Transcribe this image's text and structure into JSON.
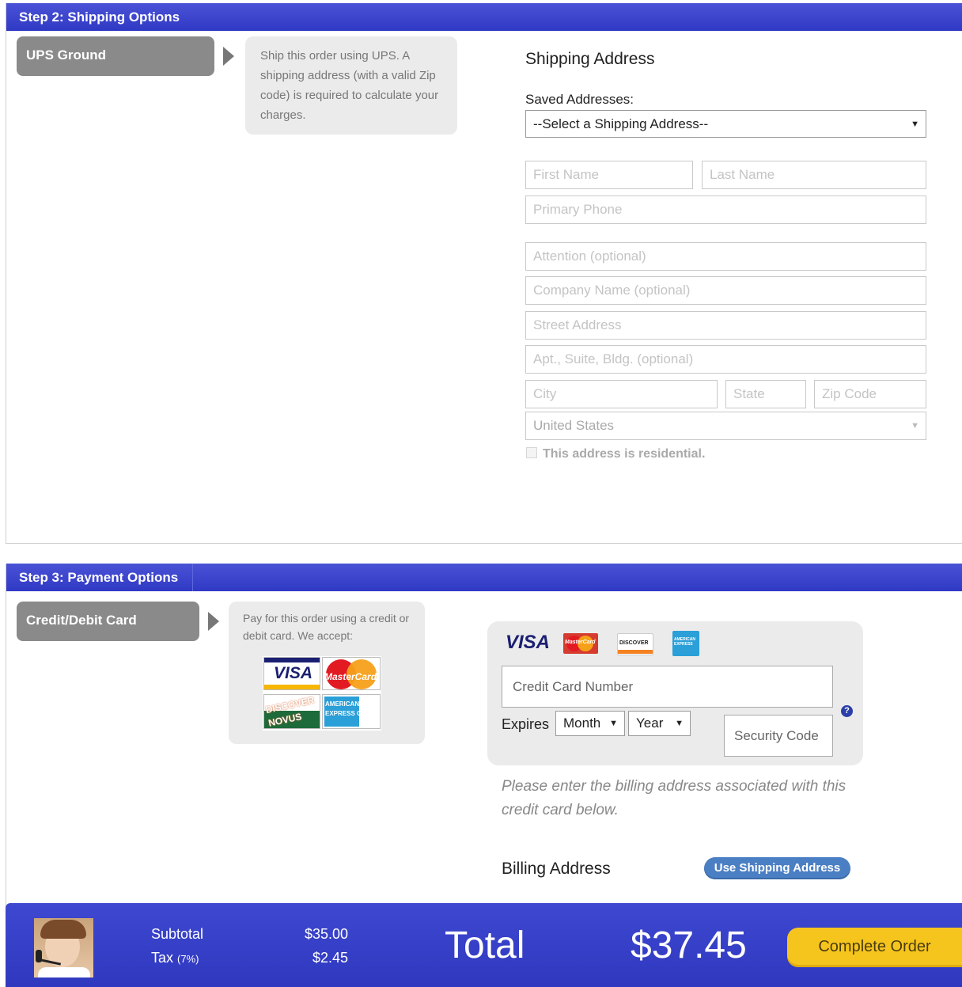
{
  "step2": {
    "title": "Step 2: Shipping Options",
    "method_label": "UPS Ground",
    "description": "Ship this order using UPS. A shipping address (with a valid Zip code) is required to calculate your charges.",
    "address_title": "Shipping Address",
    "saved_label": "Saved Addresses:",
    "saved_select_value": "--Select a Shipping Address--",
    "placeholders": {
      "first_name": "First Name",
      "last_name": "Last Name",
      "phone": "Primary Phone",
      "attention": "Attention (optional)",
      "company": "Company Name (optional)",
      "street": "Street Address",
      "apt": "Apt., Suite, Bldg. (optional)",
      "city": "City",
      "state": "State",
      "zip": "Zip Code"
    },
    "country_value": "United States",
    "residential_label": "This address is residential."
  },
  "step3": {
    "title": "Step 3: Payment Options",
    "method_label": "Credit/Debit Card",
    "description": "Pay for this order using a credit or debit card. We accept:",
    "accepted_cards": [
      "VISA",
      "MasterCard",
      "DISCOVER NOVUS",
      "AMERICAN EXPRESS Cards"
    ],
    "card_logos": [
      "VISA",
      "MasterCard",
      "DISCOVER",
      "AMERICAN EXPRESS"
    ],
    "card_number_placeholder": "Credit Card Number",
    "expires_label": "Expires",
    "month_value": "Month",
    "year_value": "Year",
    "security_placeholder": "Security Code",
    "help_icon": "?",
    "billing_note": "Please enter the billing address associated with this credit card below.",
    "billing_title": "Billing Address",
    "use_shipping_button": "Use Shipping Address"
  },
  "footer": {
    "subtotal_label": "Subtotal",
    "subtotal_value": "$35.00",
    "tax_label": "Tax",
    "tax_rate": "(7%)",
    "tax_value": "$2.45",
    "total_label": "Total",
    "total_value": "$37.45",
    "complete_button": "Complete Order"
  },
  "colors": {
    "header_blue": "#3a43cc",
    "method_gray": "#8a8a8a",
    "complete_yellow": "#f6c51d",
    "pill_blue": "#4b7fc4"
  }
}
